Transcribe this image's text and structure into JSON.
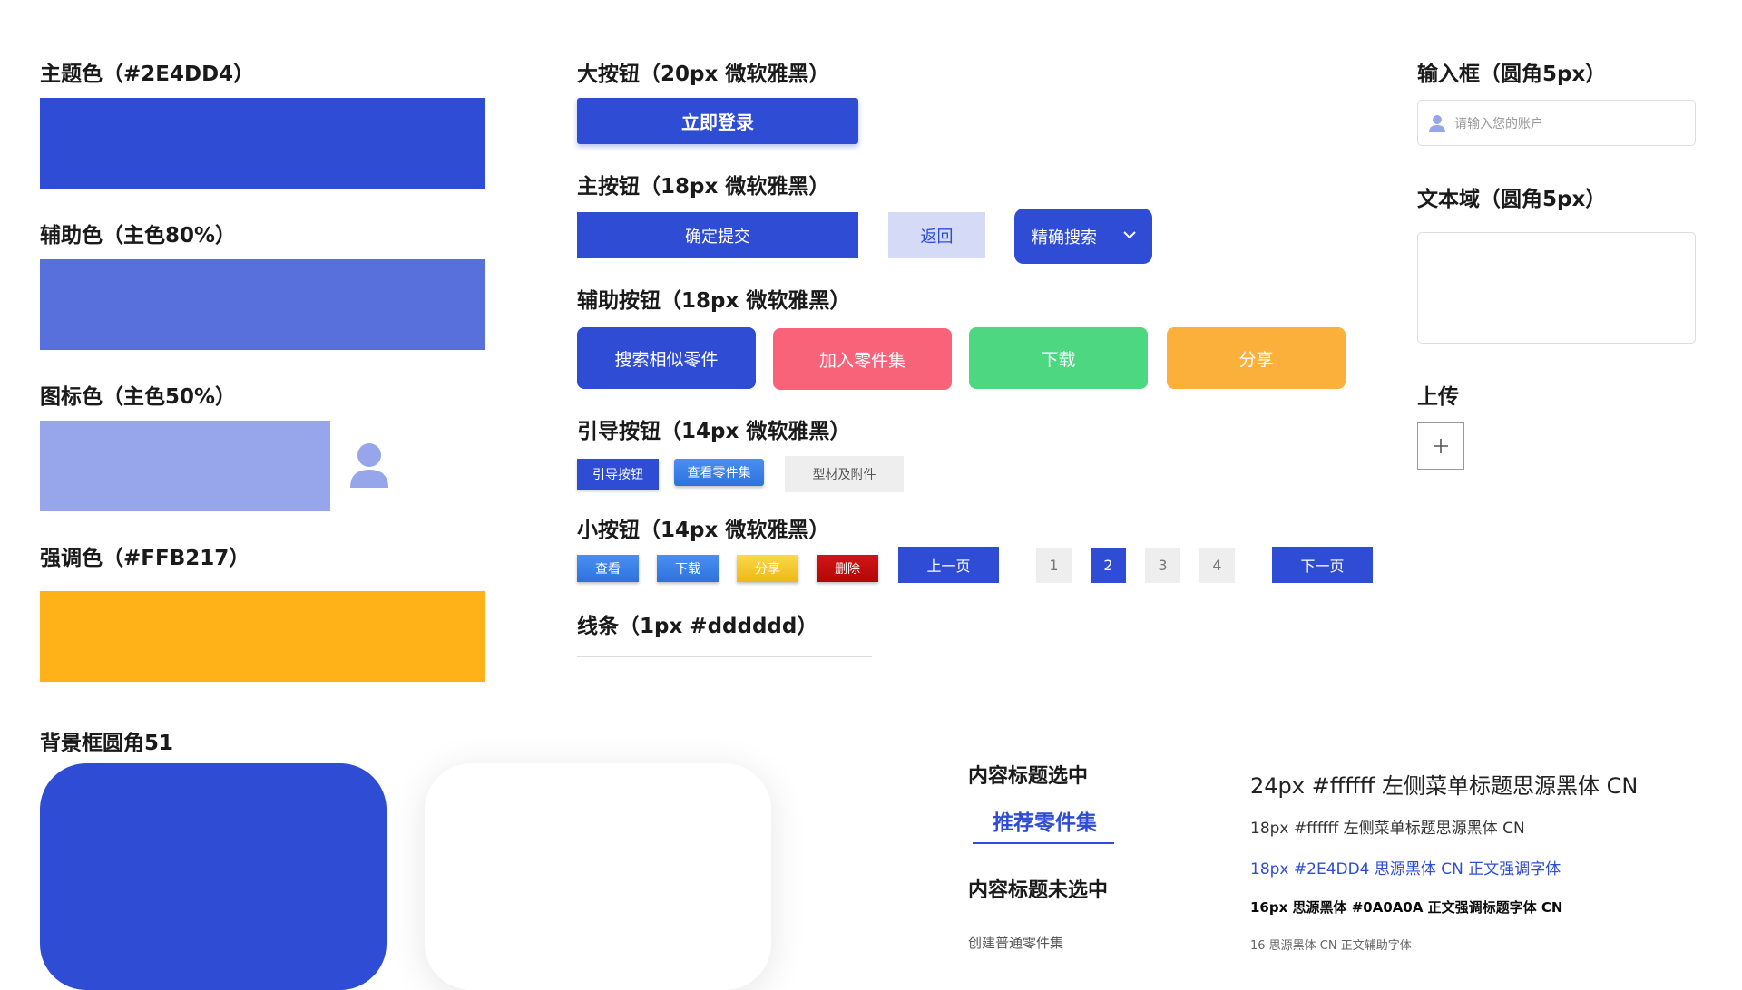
{
  "colors": {
    "primary": "#2E4DD4",
    "assist": "#5870DC",
    "icon": "#97A6EA",
    "accent": "#FFB217",
    "pink": "#F9637A",
    "green": "#4CD780",
    "orange": "#FBB03B",
    "line": "#dddddd"
  },
  "palette": {
    "primary_label": "主题色（#2E4DD4）",
    "assist_label": "辅助色（主色80%）",
    "icon_label": "图标色（主色50%）",
    "icon_name": "user-icon",
    "accent_label": "强调色（#FFB217）"
  },
  "background": {
    "label": "背景框圆角51"
  },
  "large_button": {
    "heading": "大按钮（20px  微软雅黑）",
    "label": "立即登录"
  },
  "main_buttons": {
    "heading": "主按钮（18px  微软雅黑）",
    "submit": "确定提交",
    "back": "返回",
    "search": "精确搜索",
    "search_icon": "chevron-down-icon"
  },
  "assist_buttons": {
    "heading": "辅助按钮（18px  微软雅黑）",
    "items": [
      "搜索相似零件",
      "加入零件集",
      "下载",
      "分享"
    ]
  },
  "guide_buttons": {
    "heading": "引导按钮（14px  微软雅黑）",
    "items": [
      "引导按钮",
      "查看零件集",
      "型材及附件"
    ]
  },
  "small_buttons": {
    "heading": "小按钮（14px  微软雅黑）",
    "items": [
      "查看",
      "下载",
      "分享",
      "删除"
    ],
    "prev": "上一页",
    "next": "下一页",
    "pages": [
      "1",
      "2",
      "3",
      "4"
    ],
    "current_page": "2"
  },
  "line_spec": {
    "heading": "线条（1px #dddddd）"
  },
  "input": {
    "heading": "输入框（圆角5px）",
    "placeholder": "请输入您的账户",
    "icon": "user-icon"
  },
  "textarea": {
    "heading": "文本域（圆角5px）"
  },
  "upload": {
    "heading": "上传",
    "icon": "plus-icon"
  },
  "tabs": {
    "selected_heading": "内容标题选中",
    "selected_label": "推荐零件集",
    "unselected_heading": "内容标题未选中",
    "unselected_label": "创建普通零件集"
  },
  "typography": {
    "line1": "24px #ffffff 左侧菜单标题思源黑体 CN",
    "line2": "18px #ffffff 左侧菜单标题思源黑体 CN",
    "line3": "18px #2E4DD4 思源黑体 CN 正文强调字体",
    "line4": "16px 思源黑体 #0A0A0A 正文强调标题字体 CN",
    "line5": "16 思源黑体 CN 正文辅助字体"
  }
}
